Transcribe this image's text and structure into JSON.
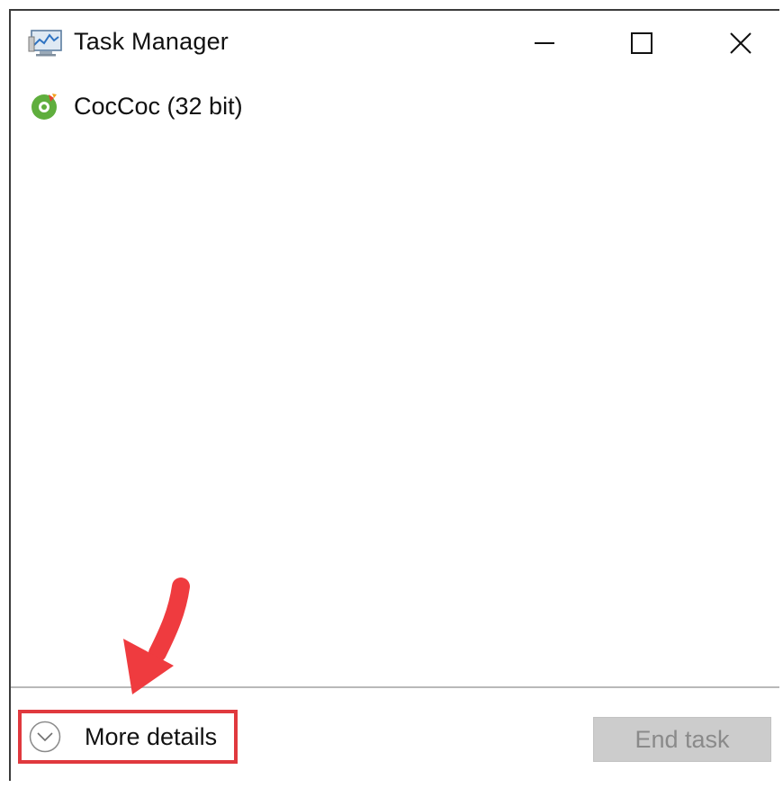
{
  "window": {
    "title": "Task Manager",
    "icon": "task-manager-icon"
  },
  "titlebar_buttons": {
    "minimize_icon": "minimize-icon",
    "maximize_icon": "maximize-icon",
    "close_icon": "close-icon"
  },
  "processes": [
    {
      "name": "CocCoc (32 bit)",
      "icon": "coccoc-icon"
    }
  ],
  "footer": {
    "more_details_label": "More details",
    "more_details_icon": "chevron-down-circle-icon",
    "end_task_label": "End task",
    "end_task_enabled": false
  },
  "annotation": {
    "arrow_color": "#ef3b3f",
    "highlight_color": "#e0393e"
  }
}
